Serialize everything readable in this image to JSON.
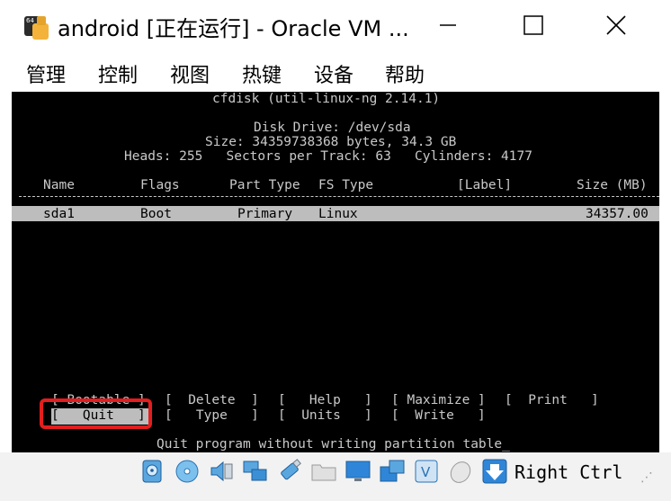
{
  "window": {
    "title": "android [正在运行] - Oracle VM ...",
    "icon": "virtualbox-64-icon",
    "buttons": {
      "minimize": "minimize-icon",
      "maximize": "maximize-icon",
      "close": "close-icon"
    }
  },
  "menu": {
    "items": [
      "管理",
      "控制",
      "视图",
      "热键",
      "设备",
      "帮助"
    ]
  },
  "console": {
    "header": "cfdisk (util-linux-ng 2.14.1)",
    "disk_drive": "Disk Drive: /dev/sda",
    "size_line": "Size: 34359738368 bytes, 34.3 GB",
    "geometry_line": "Heads: 255   Sectors per Track: 63   Cylinders: 4177",
    "columns": {
      "name": "Name",
      "flags": "Flags",
      "part_type": "Part Type",
      "fs_type": "FS Type",
      "label": "[Label]",
      "size": "Size (MB)"
    },
    "partitions": [
      {
        "name": "sda1",
        "flags": "Boot",
        "part_type": "Primary",
        "fs_type": "Linux",
        "label": "",
        "size": "34357.00"
      }
    ],
    "commands_row1": [
      "[ Bootable ]",
      "[  Delete  ]",
      "[   Help   ]",
      "[ Maximize ]",
      "[  Print   ]"
    ],
    "commands_row2": [
      "[   Quit   ]",
      "[   Type   ]",
      "[  Units   ]",
      "[  Write   ]"
    ],
    "status_message": "Quit program without writing partition table_"
  },
  "statusbar": {
    "icons": [
      "hard-disk-icon",
      "optical-drive-icon",
      "audio-icon",
      "network-icon",
      "usb-icon",
      "shared-folder-icon",
      "display-icon",
      "video-capture-icon",
      "virtualization-icon",
      "mouse-integration-icon",
      "host-key-arrow-icon"
    ],
    "host_key": "Right Ctrl"
  },
  "colors": {
    "console_bg": "#000000",
    "console_text": "#c9c9c9",
    "selection_bg": "#bdbdbd",
    "highlight_box": "#e41e1e"
  }
}
